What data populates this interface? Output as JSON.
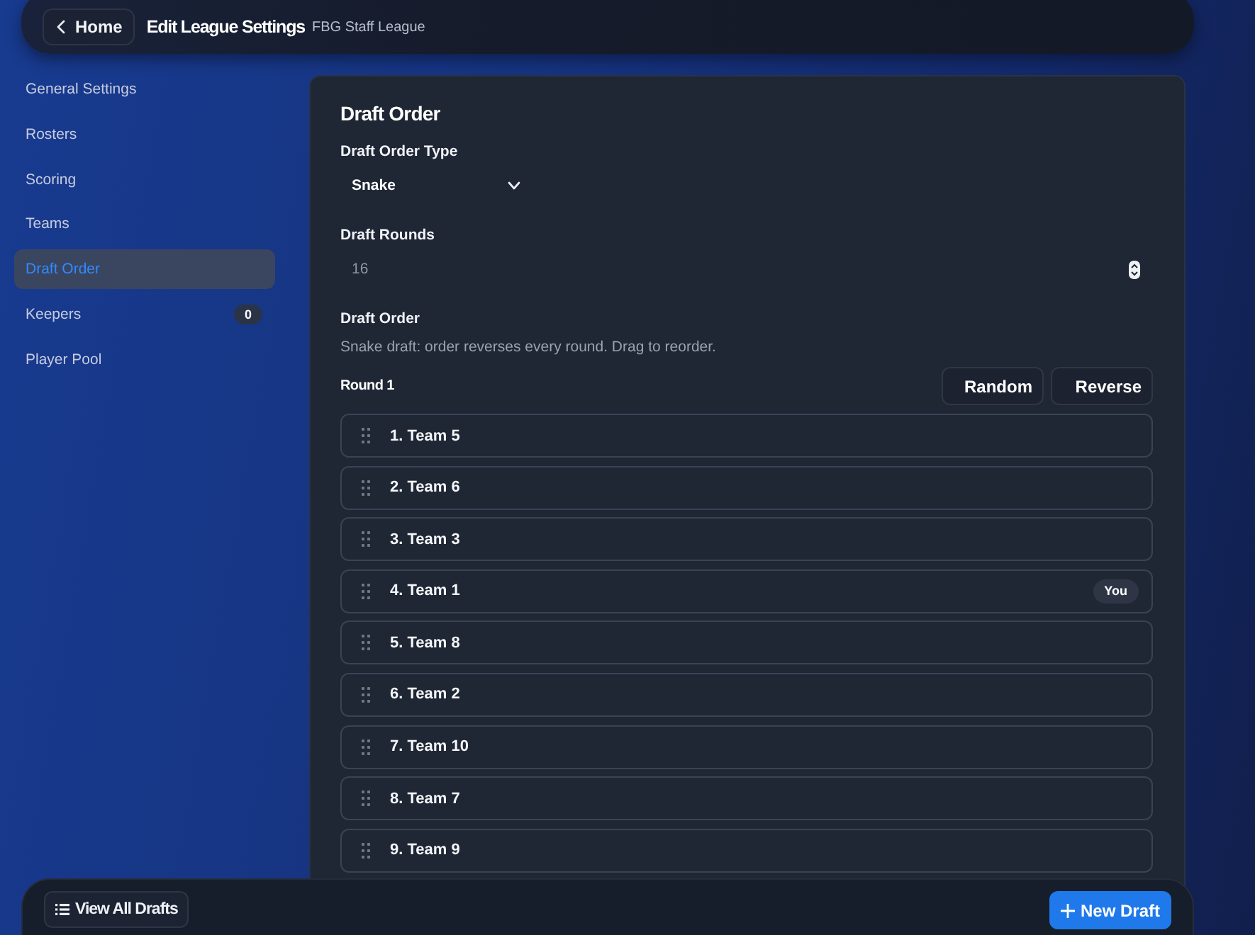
{
  "header": {
    "back_button": "Home",
    "title": "Edit League Settings",
    "subtitle": "FBG Staff League"
  },
  "sidebar": {
    "items": [
      {
        "label": "General Settings",
        "selected": false
      },
      {
        "label": "Rosters",
        "selected": false
      },
      {
        "label": "Scoring",
        "selected": false
      },
      {
        "label": "Teams",
        "selected": false
      },
      {
        "label": "Draft Order",
        "selected": true
      },
      {
        "label": "Keepers",
        "selected": false,
        "badge": "0"
      },
      {
        "label": "Player Pool",
        "selected": false
      }
    ]
  },
  "panel": {
    "title": "Draft Order",
    "fields": [
      {
        "kind": "select",
        "label": "Draft Order Type",
        "value": "Snake"
      },
      {
        "kind": "number",
        "label": "Draft Rounds",
        "value": "16"
      }
    ],
    "draft_order": {
      "label": "Draft Order",
      "help": "Snake draft: order reverses every round. Drag to reorder.",
      "round_label": "Round 1",
      "buttons": [
        "Random",
        "Reverse"
      ],
      "teams": [
        {
          "label": "1. Team 5"
        },
        {
          "label": "2. Team 6"
        },
        {
          "label": "3. Team 3"
        },
        {
          "label": "4. Team 1",
          "badge": "You"
        },
        {
          "label": "5. Team 8"
        },
        {
          "label": "6. Team 2"
        },
        {
          "label": "7. Team 10"
        },
        {
          "label": "8. Team 7"
        },
        {
          "label": "9. Team 9"
        }
      ]
    }
  },
  "footer": {
    "left_button": "View All Drafts",
    "right_button": "New Draft"
  }
}
